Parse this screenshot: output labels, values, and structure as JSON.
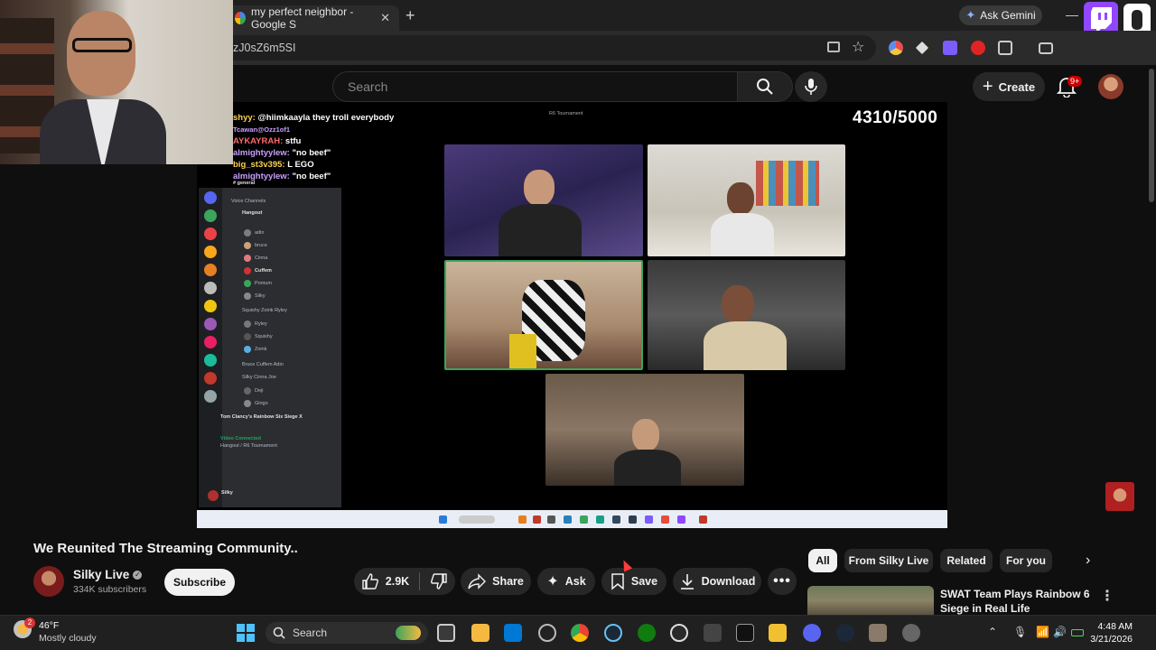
{
  "browser": {
    "tabs": [
      {
        "label": "my perfect neighbor - Google S",
        "active": true
      }
    ],
    "ask_gemini_label": "Ask Gemini",
    "address_fragment": "zJ0sZ6m5SI"
  },
  "youtube": {
    "search_placeholder": "Search",
    "create_label": "Create",
    "notification_badge": "9+"
  },
  "video": {
    "chat_lines": [
      {
        "user": "shyy:",
        "text": "@hiimkaayla they troll everybody"
      },
      {
        "user": "Tcawan@Ozz1of1",
        "text": ""
      },
      {
        "user": "AYKAYRAH:",
        "text": "stfu"
      },
      {
        "user": "almightyylew:",
        "text": "\"no beef\""
      },
      {
        "user": "big_st3v395:",
        "text": "L EGO"
      },
      {
        "user": "almightyylew:",
        "text": "\"no beef\""
      }
    ],
    "discord": {
      "channel": "# general",
      "voice_header": "Voice Channels",
      "hangout": "Hangout",
      "hangout_members": [
        "adin",
        "bruce",
        "Cinna",
        "Cuffem",
        "Pomum",
        "Silky"
      ],
      "squad1": "Squishy Zoink Ryley",
      "squad1_members": [
        "Ryley",
        "Squishy",
        "Zoink"
      ],
      "squad2": "Bruce Cuffem Adin",
      "squad3": "Silky Cinna Joe",
      "squad3_members": [
        "Deji",
        "Gingo"
      ],
      "game_title": "Tom Clancy's Rainbow Six Siege X",
      "connected": "Video Connected",
      "connected_sub": "Hangout / R6 Tournament",
      "self_name": "Silky"
    },
    "tournament_label": "R6 Tournament",
    "counter": "4310/5000"
  },
  "watch": {
    "title": "We Reunited The Streaming Community..",
    "channel_name": "Silky Live",
    "subscribers": "334K subscribers",
    "subscribe_label": "Subscribe",
    "like_count": "2.9K",
    "share_label": "Share",
    "ask_label": "Ask",
    "save_label": "Save",
    "download_label": "Download"
  },
  "chips": [
    "All",
    "From Silky Live",
    "Related",
    "For you"
  ],
  "recommendation": {
    "title": "SWAT Team Plays Rainbow 6 Siege in Real Life"
  },
  "taskbar": {
    "weather_temp": "46°F",
    "weather_desc": "Mostly cloudy",
    "weather_badge": "2",
    "search_label": "Search",
    "time": "4:48 AM",
    "date": "3/21/2026"
  },
  "colors": {
    "accent_red": "#cc0000",
    "youtube_bg": "#0f0f0f",
    "chip_bg": "#272727",
    "win_blue": "#4cc2ff"
  }
}
